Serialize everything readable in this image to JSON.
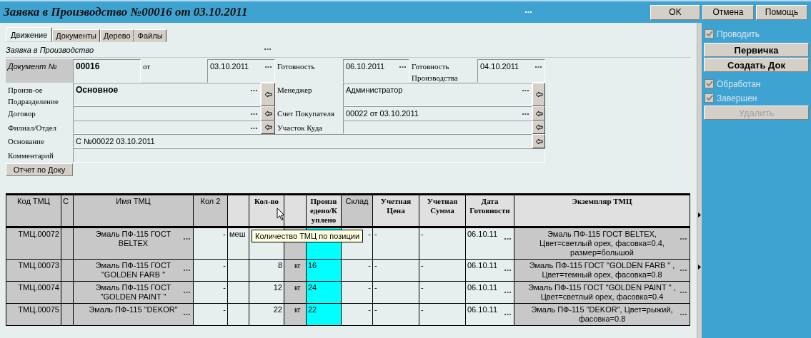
{
  "window": {
    "title": "Заявка в Производство №00016 от 03.10.2011"
  },
  "title_buttons": [
    {
      "label": "OK"
    },
    {
      "label": "Отмена"
    },
    {
      "label": "Помощь"
    }
  ],
  "tabs": [
    {
      "label": "Движение",
      "selected": true
    },
    {
      "label": "Документы",
      "selected": false
    },
    {
      "label": "Дерево",
      "selected": false
    },
    {
      "label": "Файлы",
      "selected": false
    }
  ],
  "form": {
    "caption": "Заявка в Производство",
    "fields": [
      {
        "kind": "key",
        "label": "Документ №",
        "value": "00016",
        "bold": true,
        "ellipsis": false,
        "arrow": false
      },
      {
        "kind": "plain",
        "label": "от",
        "value": "03.10.2011",
        "bold": false,
        "ellipsis": true,
        "arrow": false
      },
      {
        "kind": "plain",
        "label": "Готовность",
        "value": "06.10.2011",
        "bold": false,
        "ellipsis": true,
        "arrow": false
      },
      {
        "kind": "plain",
        "label": "Готовность Производства",
        "value": "04.10.2011",
        "bold": false,
        "ellipsis": true,
        "arrow": false
      },
      {
        "kind": "plain",
        "label": "Произв-ое Подразделение",
        "value": "Основное",
        "bold": true,
        "ellipsis": true,
        "arrow": true
      },
      {
        "kind": "plain",
        "label": "Менеджер",
        "value": "Администратор",
        "bold": false,
        "ellipsis": true,
        "arrow": true
      },
      {
        "kind": "plain",
        "label": "Договор",
        "ellipsis": true,
        "arrow": true
      },
      {
        "kind": "plain",
        "label": "Счет Покупателя",
        "value": "00022 от 03.10.2011",
        "bold": false,
        "ellipsis": true,
        "arrow": true
      },
      {
        "kind": "plain",
        "label": "Филиал/Отдел",
        "ellipsis": true,
        "arrow": true
      },
      {
        "kind": "plain",
        "label": "Участок Куда",
        "ellipsis": false,
        "arrow": true
      },
      {
        "kind": "plain",
        "label": "Основание",
        "value": "С №00022 03.10.2011",
        "bold": false,
        "ellipsis": false,
        "arrow": true
      },
      {
        "kind": "plain",
        "label": "Комментарий",
        "ellipsis": false,
        "arrow": false
      }
    ],
    "report_button": "Отчет по Доку"
  },
  "table": {
    "columns": [
      {
        "label": "Код ТМЦ"
      },
      {
        "label": "С"
      },
      {
        "label": "Имя ТМЦ",
        "ellipsis": true
      },
      {
        "label": "Кол 2"
      },
      {
        "kind": "unit"
      },
      {
        "label": "Кол-во"
      },
      {
        "kind": "unit"
      },
      {
        "label": "Произв едено/К уплено"
      },
      {
        "label": "Склад"
      },
      {
        "label": "Учетная Цена"
      },
      {
        "label": "Учетная Сумма"
      },
      {
        "label": "Дата Готовности",
        "ellipsis": true
      },
      {
        "label": "Экземпляр ТМЦ",
        "ellipsis": true
      }
    ],
    "rows": [
      [
        "ТМЦ.00072",
        null,
        "Эмаль ПФ-115 ГОСТ BELTEX",
        "-",
        "меш",
        null,
        null,
        null,
        "-",
        "-",
        "-",
        "06.10.11",
        "Эмаль ПФ-115 ГОСТ BELTEX, Цвет=светлый орех, фасовка=0.4, размер=большой"
      ],
      [
        "ТМЦ.00073",
        null,
        "Эмаль ПФ-115 ГОСТ \"GOLDEN FARB \"",
        "-",
        null,
        "8",
        "кг",
        "16",
        "-",
        "-",
        "-",
        "06.10.11",
        "Эмаль ПФ-115 ГОСТ \"GOLDEN FARB \" , Цвет=темный орех, фасовка=0.8"
      ],
      [
        "ТМЦ.00074",
        null,
        "Эмаль ПФ-115 ГОСТ \"GOLDEN PAINT \"",
        "-",
        null,
        "12",
        "кг",
        "24",
        "-",
        "-",
        "-",
        "06.10.11",
        "Эмаль ПФ-115 ГОСТ \"GOLDEN PAINT \" , Цвет=светлый орех, фасовка=0.4"
      ],
      [
        "ТМЦ.00075",
        null,
        "Эмаль ПФ-115 \"DEKOR\"",
        "-",
        null,
        "22",
        "кг",
        "22",
        "-",
        "-",
        "-",
        "06.10.11",
        "Эмаль ПФ-115 \"DEKOR\", Цвет=рыжий, фасовка=0.8"
      ]
    ]
  },
  "tooltip": "Количество ТМЦ по позиции",
  "side_panel": {
    "items": [
      {
        "kind": "checkbox",
        "label": "Проводить",
        "checked": true,
        "disabled": true
      },
      {
        "kind": "button",
        "label": "Первичка",
        "disabled": false
      },
      {
        "kind": "button",
        "label": "Создать Док",
        "disabled": false
      },
      {
        "kind": "checkbox",
        "label": "Обработан",
        "checked": true,
        "disabled": true
      },
      {
        "kind": "checkbox",
        "label": "Завершен",
        "checked": true,
        "disabled": true
      },
      {
        "kind": "button",
        "label": "Удалить",
        "disabled": true
      }
    ]
  }
}
